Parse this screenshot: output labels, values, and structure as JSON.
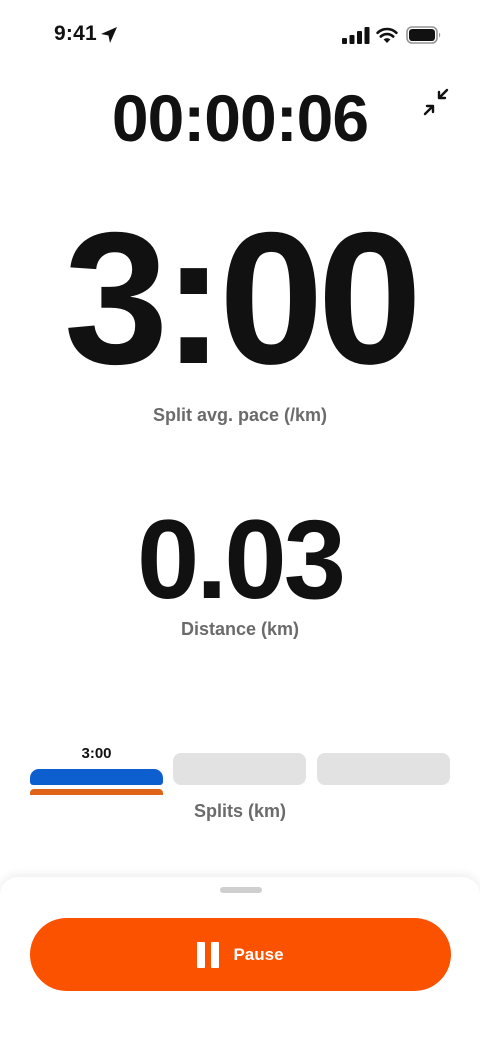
{
  "status_bar": {
    "time": "9:41",
    "location_icon": "location-arrow-icon",
    "signal_icon": "cellular-signal-icon",
    "wifi_icon": "wifi-icon",
    "battery_icon": "battery-full-icon"
  },
  "timer": {
    "elapsed": "00:00:06",
    "collapse_icon": "collapse-arrows-icon"
  },
  "pace": {
    "value": "3:00",
    "label": "Split avg. pace (/km)"
  },
  "distance": {
    "value": "0.03",
    "label": "Distance (km)"
  },
  "splits": {
    "current_value": "3:00",
    "label": "Splits (km)",
    "colors": {
      "active_bar": "#0d5fd0",
      "active_underline": "#e0631a",
      "empty_bar": "#e2e2e2"
    }
  },
  "controls": {
    "pause_label": "Pause",
    "pause_icon": "pause-icon",
    "accent": "#fb5200"
  }
}
